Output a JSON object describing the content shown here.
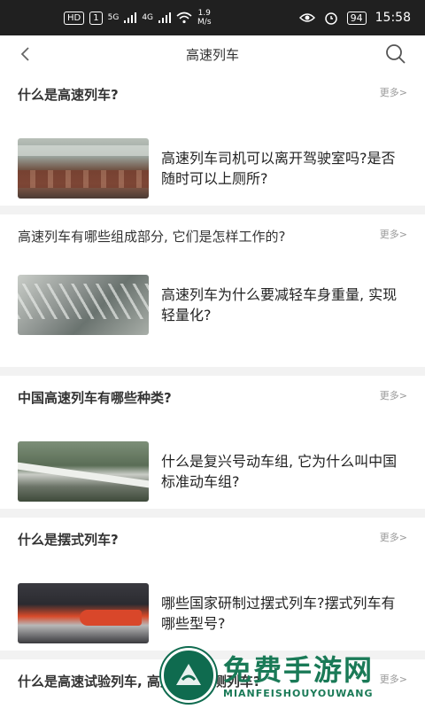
{
  "status": {
    "hd_label": "HD",
    "sim": "1",
    "net1": "5G",
    "net2": "4G",
    "speed_value": "1.9",
    "speed_unit": "M/s",
    "battery": "94",
    "time": "15:58"
  },
  "header": {
    "title": "高速列车",
    "back_icon": "chevron-left-icon",
    "search_icon": "search-icon"
  },
  "sections": [
    {
      "title": "什么是高速列车?",
      "more": "更多>",
      "article_title": "高速列车司机可以离开驾驶室吗?是否随时可以上厕所?"
    },
    {
      "title": "高速列车有哪些组成部分, 它们是怎样工作的?",
      "more": "更多>",
      "article_title": "高速列车为什么要减轻车身重量, 实现轻量化?"
    },
    {
      "title": "中国高速列车有哪些种类?",
      "more": "更多>",
      "article_title": "什么是复兴号动车组, 它为什么叫中国标准动车组?"
    },
    {
      "title": "什么是摆式列车?",
      "more": "更多>",
      "article_title": "哪些国家研制过摆式列车?摆式列车有哪些型号?"
    },
    {
      "title": "什么是高速试验列车, 高速综合检测列车?",
      "more": "更多>"
    }
  ],
  "watermark": {
    "cn": "免费手游网",
    "en": "MIANFEISHOUYOUWANG"
  },
  "colors": {
    "accent": "#1a7a57",
    "status_bar": "#202020"
  }
}
